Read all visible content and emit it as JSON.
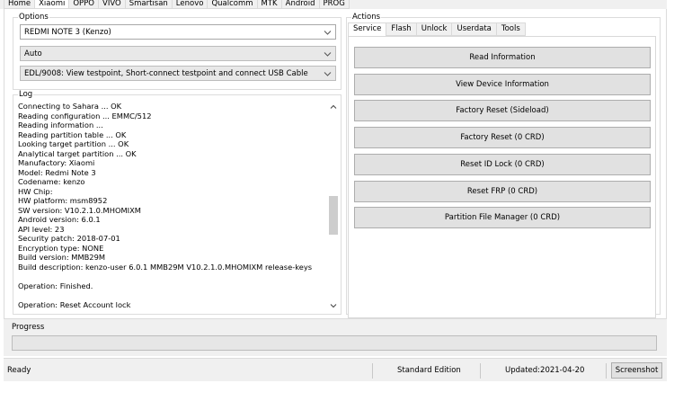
{
  "tabs": [
    {
      "label": "Home",
      "active": false
    },
    {
      "label": "Xiaomi",
      "active": true
    },
    {
      "label": "OPPO",
      "active": false
    },
    {
      "label": "VIVO",
      "active": false
    },
    {
      "label": "Smartisan",
      "active": false
    },
    {
      "label": "Lenovo",
      "active": false
    },
    {
      "label": "Qualcomm",
      "active": false
    },
    {
      "label": "MTK",
      "active": false
    },
    {
      "label": "Android",
      "active": false
    },
    {
      "label": "PROG",
      "active": false
    }
  ],
  "options": {
    "title": "Options",
    "model_value": "REDMI NOTE 3 (Kenzo)",
    "mode_value": "Auto",
    "method_value": "EDL/9008: View testpoint, Short-connect testpoint and connect USB Cable"
  },
  "log": {
    "title": "Log",
    "lines": [
      "Connecting to Sahara ... OK",
      "Reading configuration ... EMMC/512",
      "Reading information ...",
      "Reading partition table ... OK",
      "Looking target partition ... OK",
      "Analytical target partition ... OK",
      "Manufactory: Xiaomi",
      "Model: Redmi Note 3",
      "Codename: kenzo",
      "HW Chip:",
      "HW platform: msm8952",
      "SW version: V10.2.1.0.MHOMIXM",
      "Android version: 6.0.1",
      "API level: 23",
      "Security patch: 2018-07-01",
      "Encryption type: NONE",
      "Build version: MMB29M",
      "Build description: kenzo-user 6.0.1 MMB29M V10.2.1.0.MHOMIXM release-keys",
      "",
      "Operation: Finished.",
      "",
      "Operation: Reset Account lock"
    ]
  },
  "actions": {
    "title": "Actions",
    "tabs": [
      {
        "label": "Service",
        "active": true
      },
      {
        "label": "Flash",
        "active": false
      },
      {
        "label": "Unlock",
        "active": false
      },
      {
        "label": "Userdata",
        "active": false
      },
      {
        "label": "Tools",
        "active": false
      }
    ],
    "buttons": [
      "Read Information",
      "View Device Information",
      "Factory Reset (Sideload)",
      "Factory Reset (0 CRD)",
      "Reset ID Lock (0 CRD)",
      "Reset FRP (0 CRD)",
      "Partition File Manager (0 CRD)"
    ]
  },
  "progress": {
    "label": "Progress",
    "value": 0
  },
  "status": {
    "ready": "Ready",
    "edition": "Standard Edition",
    "updated": "Updated:2021-04-20",
    "screenshot_button": "Screenshot"
  },
  "icons": {
    "dropdown": "chevron-down-icon",
    "scroll_up": "chevron-up-icon",
    "scroll_down": "chevron-down-icon"
  }
}
